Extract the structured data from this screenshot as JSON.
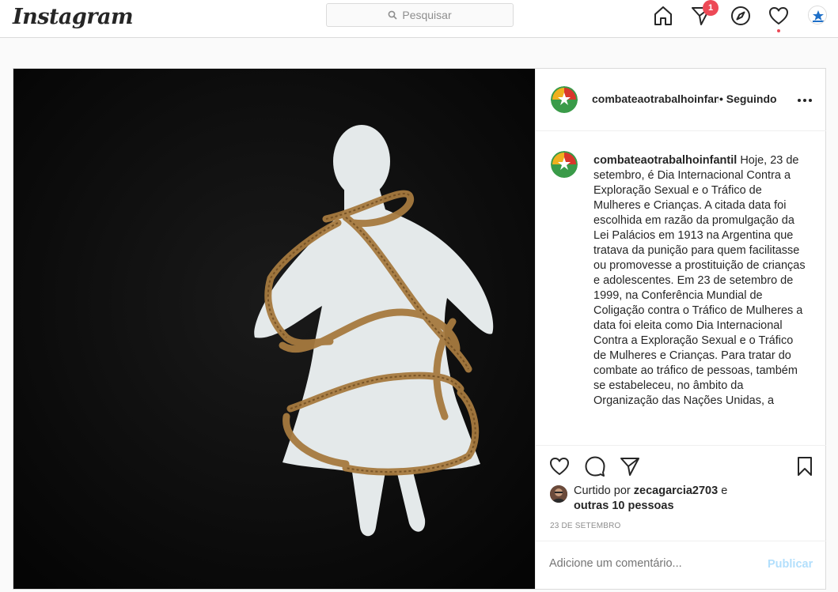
{
  "app": {
    "logo_text": "Instagram"
  },
  "search": {
    "placeholder": "Pesquisar"
  },
  "nav": {
    "icons": [
      "home-icon",
      "direct-icon",
      "explore-icon",
      "activity-icon",
      "profile-avatar"
    ],
    "direct_badge": "1"
  },
  "post": {
    "username": "combateaotrabalhoinfantil",
    "follow_status": "• Seguindo",
    "caption_user": "combateaotrabalhoinfantil",
    "caption_text": "Hoje, 23 de setembro, é Dia Internacional Contra a Exploração Sexual e o Tráfico de Mulheres e Crianças. A citada data foi escolhida em razão da promulgação da Lei Palácios em 1913 na Argentina que tratava da punição para quem facilitasse ou promovesse a prostituição de crianças e adolescentes. Em 23 de setembro de 1999, na Conferência Mundial de Coligação contra o Tráfico de Mulheres a data foi eleita como Dia Internacional Contra a Exploração Sexual e o Tráfico de Mulheres e Crianças. Para tratar do combate ao tráfico de pessoas, também se estabeleceu, no âmbito da Organização das Nações Unidas, a",
    "liked_prefix": "Curtido por ",
    "liked_user": "zecagarcia2703",
    "liked_mid": " e",
    "liked_others": "outras 10 pessoas",
    "date": "23 DE SETEMBRO",
    "comment_placeholder": "Adicione um comentário...",
    "publish_label": "Publicar"
  },
  "colors": {
    "accent_blue": "#0095f6",
    "badge_red": "#ed4956",
    "publish_disabled": "#b2dffc"
  }
}
